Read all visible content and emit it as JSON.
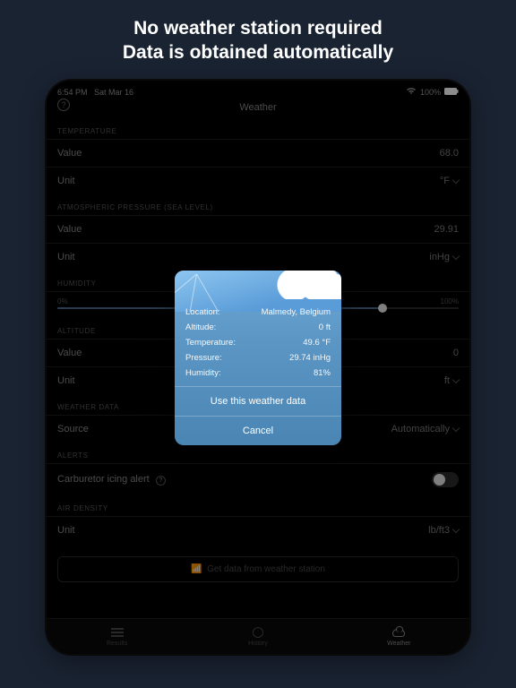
{
  "promo": {
    "line1": "No weather station required",
    "line2": "Data is obtained automatically"
  },
  "statusbar": {
    "time": "6:54 PM",
    "date": "Sat Mar 16",
    "battery": "100%"
  },
  "screen": {
    "title": "Weather"
  },
  "sections": {
    "temperature": {
      "header": "TEMPERATURE",
      "value_label": "Value",
      "value": "68.0",
      "unit_label": "Unit",
      "unit": "°F"
    },
    "pressure": {
      "header": "ATMOSPHERIC PRESSURE (SEA LEVEL)",
      "value_label": "Value",
      "value": "29.91",
      "unit_label": "Unit",
      "unit": "inHg"
    },
    "humidity": {
      "header": "HUMIDITY",
      "min": "0%",
      "value": "81%",
      "max": "100%"
    },
    "altitude": {
      "header": "ALTITUDE",
      "value_label": "Value",
      "value": "0",
      "unit_label": "Unit",
      "unit": "ft"
    },
    "weatherdata": {
      "header": "WEATHER DATA",
      "source_label": "Source",
      "source": "Automatically"
    },
    "alerts": {
      "header": "ALERTS",
      "carb_label": "Carburetor icing alert"
    },
    "airdensity": {
      "header": "AIR DENSITY",
      "unit_label": "Unit",
      "unit": "lb/ft3"
    }
  },
  "station_button": "Get data from weather station",
  "tabs": {
    "results": "Results",
    "history": "History",
    "weather": "Weather"
  },
  "modal": {
    "rows": {
      "location_k": "Location:",
      "location_v": "Malmedy, Belgium",
      "altitude_k": "Altitude:",
      "altitude_v": "0 ft",
      "temp_k": "Temperature:",
      "temp_v": "49.6 °F",
      "pressure_k": "Pressure:",
      "pressure_v": "29.74 inHg",
      "humidity_k": "Humidity:",
      "humidity_v": "81%"
    },
    "use_btn": "Use this weather data",
    "cancel_btn": "Cancel"
  }
}
